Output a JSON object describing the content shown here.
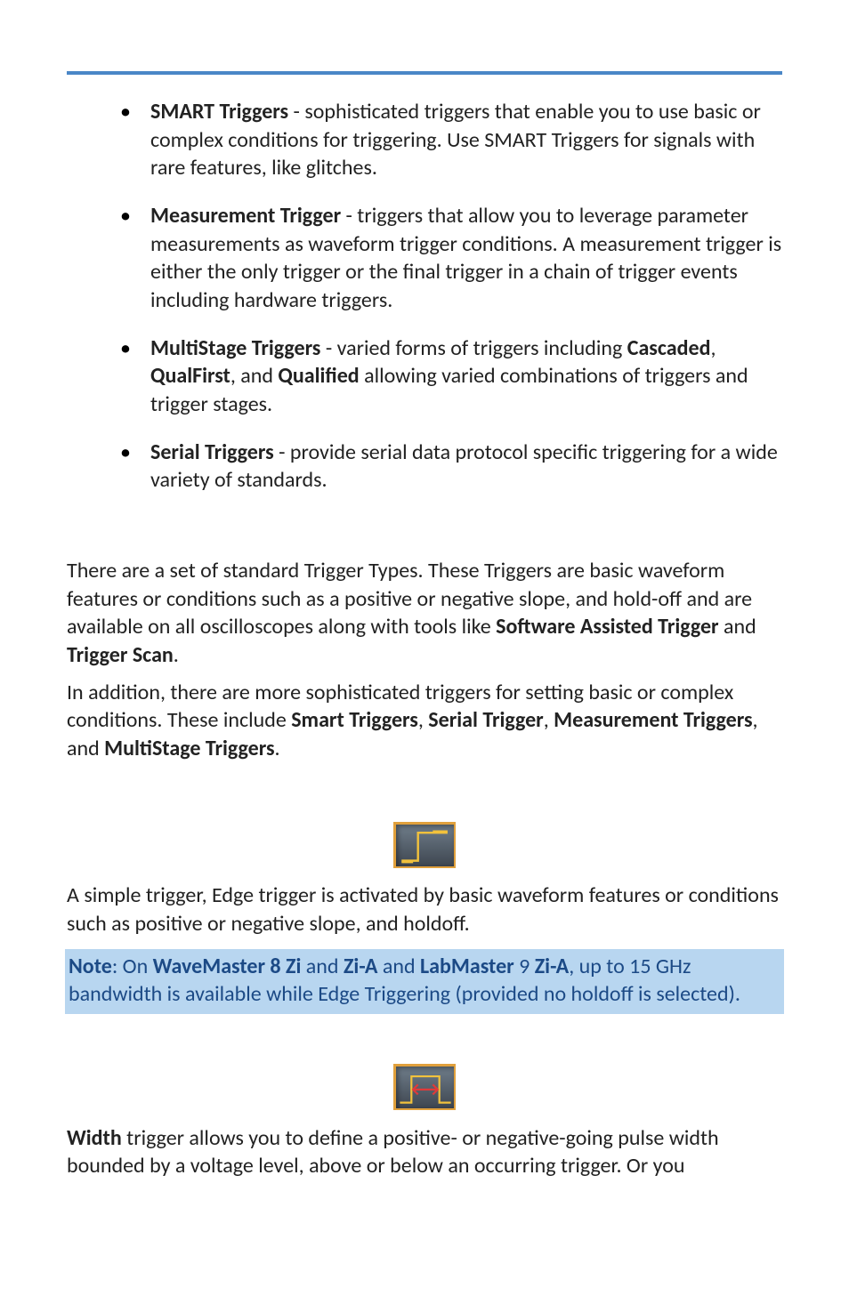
{
  "bullets": [
    {
      "name": "bullet-smart-triggers",
      "parts": [
        {
          "text": "SMART Triggers",
          "bold": true
        },
        {
          "text": " - sophisticated triggers that enable you to use basic or complex conditions for triggering. Use SMART Triggers for signals with rare features, like glitches."
        }
      ]
    },
    {
      "name": "bullet-measurement-trigger",
      "parts": [
        {
          "text": "Measurement Trigger",
          "bold": true
        },
        {
          "text": " - triggers that allow you to leverage parameter measurements as waveform trigger conditions. A measurement trigger is either the only trigger or the final trigger in a chain of trigger events including hardware triggers."
        }
      ]
    },
    {
      "name": "bullet-multistage-triggers",
      "parts": [
        {
          "text": "MultiStage Triggers",
          "bold": true
        },
        {
          "text": " - varied forms of triggers including "
        },
        {
          "text": "Cascaded",
          "bold": true
        },
        {
          "text": ", "
        },
        {
          "text": "QualFirst",
          "bold": true
        },
        {
          "text": ", and "
        },
        {
          "text": "Qualified",
          "bold": true
        },
        {
          "text": " allowing varied combinations of triggers and trigger stages."
        }
      ]
    },
    {
      "name": "bullet-serial-triggers",
      "parts": [
        {
          "text": "Serial Triggers",
          "bold": true
        },
        {
          "text": " - provide serial data protocol specific triggering for a wide variety of standards."
        }
      ]
    }
  ],
  "para1": {
    "name": "para-trigger-types",
    "parts": [
      {
        "text": "There are a set of standard Trigger Types. These Triggers are basic waveform features or conditions such as a positive or negative slope, and hold-off and are available on all oscilloscopes along with tools like "
      },
      {
        "text": "Software Assisted Trigger",
        "bold": true
      },
      {
        "text": " and "
      },
      {
        "text": "Trigger Scan",
        "bold": true
      },
      {
        "text": "."
      }
    ]
  },
  "para2": {
    "name": "para-sophisticated-triggers",
    "parts": [
      {
        "text": "In addition, there are more sophisticated triggers for setting basic or complex conditions. These include "
      },
      {
        "text": "Smart Triggers",
        "bold": true
      },
      {
        "text": ", "
      },
      {
        "text": "Serial Trigger",
        "bold": true
      },
      {
        "text": ", "
      },
      {
        "text": "Measurement Triggers",
        "bold": true
      },
      {
        "text": ", and "
      },
      {
        "text": "MultiStage Triggers",
        "bold": true
      },
      {
        "text": "."
      }
    ]
  },
  "edge": {
    "name": "para-edge-trigger",
    "parts": [
      {
        "text": "A simple trigger, Edge trigger is activated by basic waveform features or conditions such as positive or negative slope, and holdoff."
      }
    ]
  },
  "note": {
    "name": "note-wavemaster",
    "parts": [
      {
        "text": "Note",
        "bold": true
      },
      {
        "text": ": On "
      },
      {
        "text": "WaveMaster 8 Zi",
        "bold": true
      },
      {
        "text": " and "
      },
      {
        "text": "Zi-A",
        "bold": true
      },
      {
        "text": " and "
      },
      {
        "text": "LabMaster",
        "bold": true
      },
      {
        "text": " 9 "
      },
      {
        "text": "Zi-A",
        "bold": true
      },
      {
        "text": ", up to 15 GHz bandwidth is available while Edge Triggering (provided no holdoff is selected)."
      }
    ]
  },
  "width": {
    "name": "para-width-trigger",
    "parts": [
      {
        "text": "Width",
        "bold": true
      },
      {
        "text": " trigger allows you to define a positive- or negative-going pulse width bounded by a voltage level, above or below an occurring trigger. Or you"
      }
    ]
  },
  "icons": {
    "edge": "edge-trigger-icon",
    "width": "width-trigger-icon"
  }
}
